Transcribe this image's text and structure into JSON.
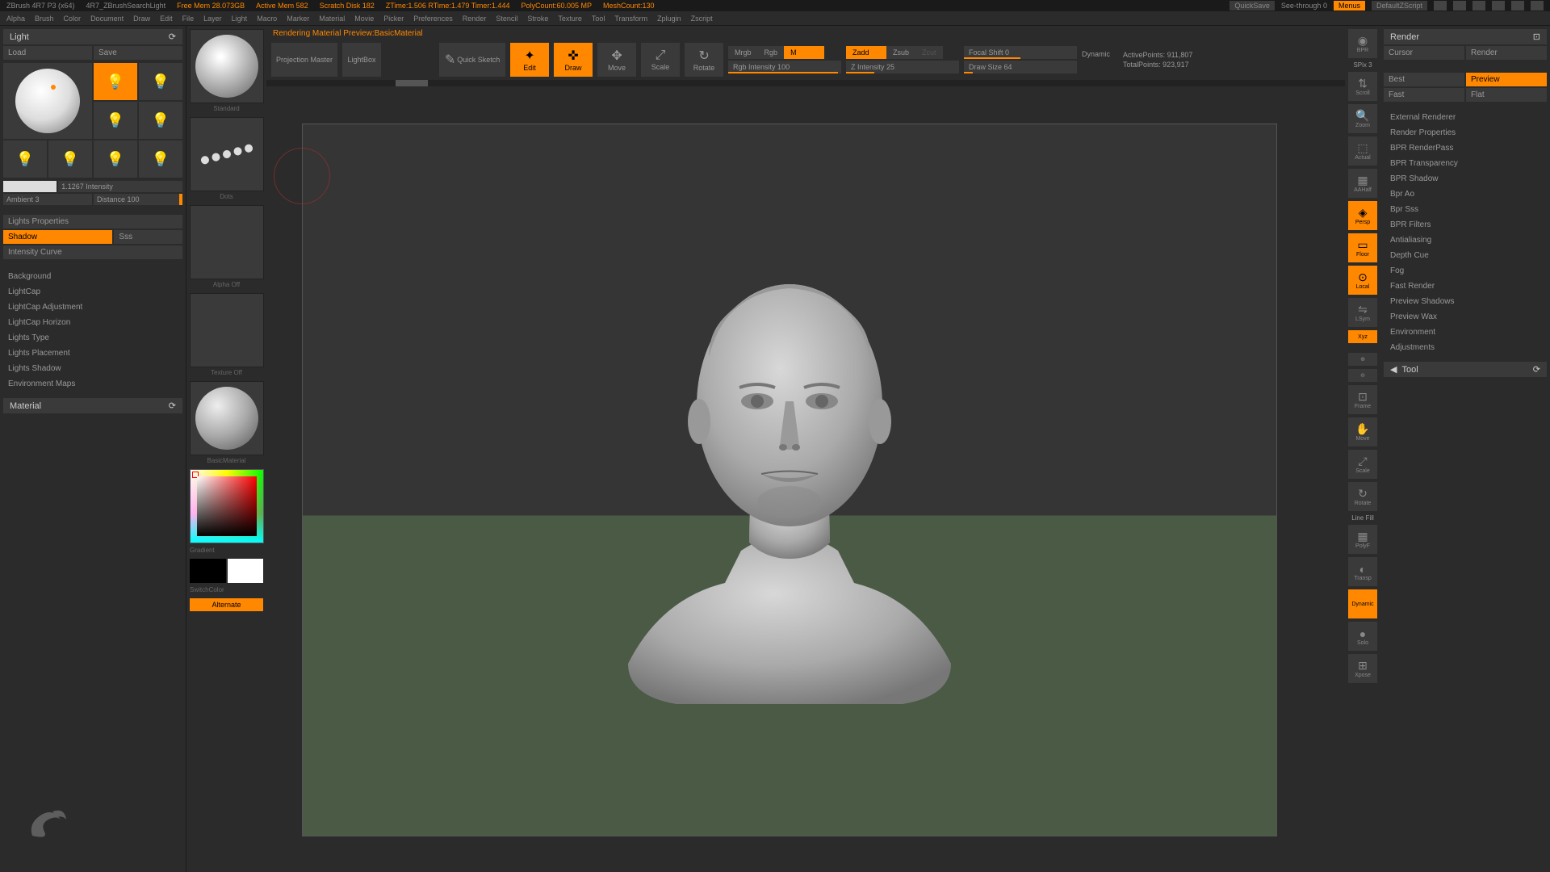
{
  "top_bar": {
    "title": "ZBrush 4R7 P3 (x64)",
    "extra": "4R7_ZBrushSearchLight",
    "freemem": "Free Mem 28.073GB",
    "activemem": "Active Mem 582",
    "scratch": "Scratch Disk 182",
    "ztime": "ZTime:1.506 RTime:1.479 Timer:1.444",
    "polycount": "PolyCount:60.005 MP",
    "meshcount": "MeshCount:130",
    "quicksave": "QuickSave",
    "seethrough": "See-through  0",
    "menus": "Menus",
    "shader": "DefaultZScript"
  },
  "menus": [
    "Alpha",
    "Brush",
    "Color",
    "Document",
    "Draw",
    "Edit",
    "File",
    "Layer",
    "Light",
    "Macro",
    "Marker",
    "Material",
    "Movie",
    "Picker",
    "Preferences",
    "Render",
    "Stencil",
    "Stroke",
    "Texture",
    "Tool",
    "Transform",
    "Zplugin",
    "Zscript"
  ],
  "status_line": "Rendering Material Preview:BasicMaterial",
  "left": {
    "header": "Light",
    "load": "Load",
    "save": "Save",
    "intensity_lbl": "1.1267 Intensity",
    "ambient": "Ambient 3",
    "distance": "Distance 100",
    "props": "Lights Properties",
    "shadow": "Shadow",
    "sss": "Sss",
    "curve": "Intensity Curve",
    "items": [
      "Background",
      "LightCap",
      "LightCap Adjustment",
      "LightCap Horizon",
      "Lights Type",
      "Lights Placement",
      "Lights Shadow",
      "Environment Maps"
    ],
    "material": "Material"
  },
  "strip": {
    "standard": "Standard",
    "dots": "Dots",
    "alpha": "Alpha Off",
    "texture": "Texture Off",
    "basicmat": "BasicMaterial",
    "gradient": "Gradient",
    "switchcolor": "SwitchColor",
    "alternate": "Alternate"
  },
  "tools": {
    "projection": "Projection Master",
    "lightbox": "LightBox",
    "quicksketch": "Quick Sketch",
    "edit": "Edit",
    "draw": "Draw",
    "move": "Move",
    "scale": "Scale",
    "rotate": "Rotate",
    "mrgb": "Mrgb",
    "rgb": "Rgb",
    "m": "M",
    "zadd": "Zadd",
    "zsub": "Zsub",
    "zcut": "Zcut",
    "rgbint": "Rgb Intensity 100",
    "zint": "Z Intensity 25",
    "focal": "Focal Shift 0",
    "drawsize": "Draw Size 64",
    "dynamic": "Dynamic",
    "active": "ActivePoints: 911,807",
    "total": "TotalPoints: 923,917"
  },
  "rstrip": {
    "bpr": "BPR",
    "spix": "SPix 3",
    "scroll": "Scroll",
    "zoom": "Zoom",
    "actual": "Actual",
    "aahalf": "AAHalf",
    "persp": "Persp",
    "floor": "Floor",
    "local": "Local",
    "lsym": "LSym",
    "xyz": "Xyz",
    "frame": "Frame",
    "move": "Move",
    "scale": "Scale",
    "rotate": "Rotate",
    "linefill": "Line Fill",
    "polyf": "PolyF",
    "transp": "Transp",
    "dynamic": "Dynamic",
    "solo": "Solo",
    "xpose": "Xpose"
  },
  "right": {
    "header": "Render",
    "cursor": "Cursor",
    "render": "Render",
    "best": "Best",
    "preview": "Preview",
    "fast": "Fast",
    "flat": "Flat",
    "items": [
      "External Renderer",
      "Render Properties",
      "BPR RenderPass",
      "BPR Transparency",
      "BPR Shadow",
      "Bpr Ao",
      "Bpr Sss",
      "BPR Filters",
      "Antialiasing",
      "Depth Cue",
      "Fog",
      "Fast Render",
      "Preview Shadows",
      "Preview Wax",
      "Environment",
      "Adjustments"
    ],
    "tool": "Tool"
  }
}
